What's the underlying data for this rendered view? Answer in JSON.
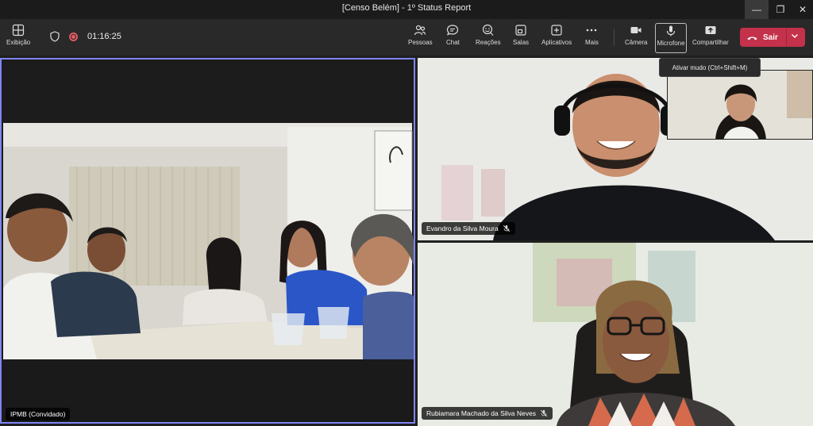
{
  "window": {
    "title": "[Censo Belém] - 1º Status Report"
  },
  "toolbar": {
    "view_label": "Exibição",
    "timer": "01:16:25",
    "people_label": "Pessoas",
    "chat_label": "Chat",
    "reactions_label": "Reações",
    "rooms_label": "Salas",
    "apps_label": "Aplicativos",
    "more_label": "Mais",
    "camera_label": "Câmera",
    "mic_label": "Microfone",
    "share_label": "Compartilhar",
    "leave_label": "Sair"
  },
  "tooltip": {
    "text": "Ativar mudo (Ctrl+Shift+M)"
  },
  "participants": {
    "main": {
      "name": "IPMB (Convidado)"
    },
    "top_right": {
      "name": "Evandro da Silva Moura"
    },
    "bottom_right": {
      "name": "Rubiamara Machado da Silva Neves"
    }
  },
  "colors": {
    "accent": "#7f85f5",
    "leave": "#c4314b",
    "background": "#1f1f1f"
  }
}
